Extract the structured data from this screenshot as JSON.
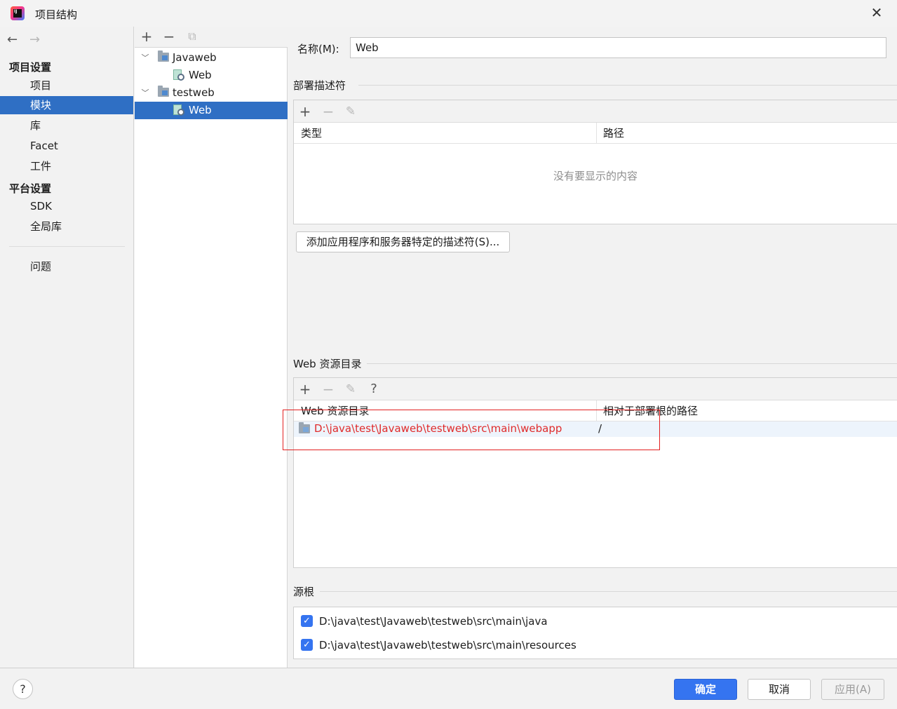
{
  "window": {
    "title": "项目结构",
    "close": "✕"
  },
  "nav": {
    "back": "←",
    "forward": "→",
    "project_settings_header": "项目设置",
    "project_items": [
      "项目",
      "模块",
      "库",
      "Facet",
      "工件"
    ],
    "selected_item": "模块",
    "platform_settings_header": "平台设置",
    "platform_items": [
      "SDK",
      "全局库"
    ],
    "problems": "问题"
  },
  "tree": {
    "toolbar": {
      "add": "+",
      "remove": "−",
      "copy": "⧉"
    },
    "nodes": [
      {
        "label": "Javaweb",
        "level": 0,
        "expanded": true,
        "type": "module"
      },
      {
        "label": "Web",
        "level": 1,
        "type": "web-facet"
      },
      {
        "label": "testweb",
        "level": 0,
        "expanded": true,
        "type": "module"
      },
      {
        "label": "Web",
        "level": 1,
        "type": "web-facet",
        "selected": true
      }
    ]
  },
  "main": {
    "name_label": "名称(M):",
    "name_value": "Web",
    "deployment": {
      "title": "部署描述符",
      "toolbar": {
        "add": "+",
        "remove": "−",
        "edit": "✎"
      },
      "columns": [
        "类型",
        "路径"
      ],
      "empty_text": "没有要显示的内容",
      "add_button": "添加应用程序和服务器特定的描述符(S)..."
    },
    "web_resources": {
      "title": "Web 资源目录",
      "toolbar": {
        "add": "+",
        "remove": "−",
        "edit": "✎",
        "help": "?"
      },
      "columns": [
        "Web 资源目录",
        "相对于部署根的路径"
      ],
      "rows": [
        {
          "directory": "D:\\java\\test\\Javaweb\\testweb\\src\\main\\webapp",
          "relative_path": "/"
        }
      ],
      "highlight_color": "#e32020"
    },
    "source_roots": {
      "title": "源根",
      "items": [
        {
          "path": "D:\\java\\test\\Javaweb\\testweb\\src\\main\\java",
          "checked": true
        },
        {
          "path": "D:\\java\\test\\Javaweb\\testweb\\src\\main\\resources",
          "checked": true
        }
      ]
    }
  },
  "footer": {
    "help": "?",
    "ok": "确定",
    "cancel": "取消",
    "apply": "应用(A)"
  },
  "colors": {
    "accent": "#3574f0",
    "selection": "#2f6fc4",
    "error_text": "#e02b2b"
  }
}
